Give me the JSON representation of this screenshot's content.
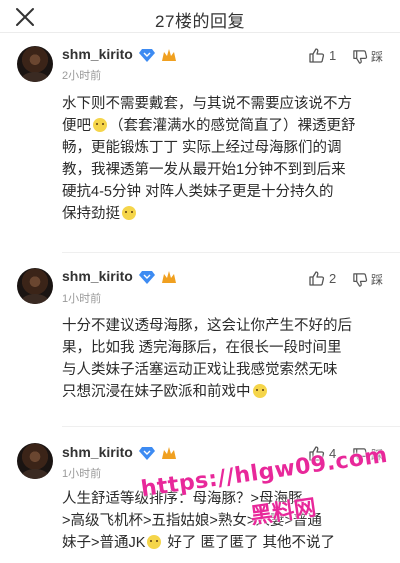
{
  "header": {
    "title": "27楼的回复",
    "close_icon": "close-icon"
  },
  "comments": [
    {
      "username": "shm_kirito",
      "time": "2小时前",
      "likes": "1",
      "dislike_label": "踩",
      "lines": [
        "水下则不需要戴套，与其说不需要应该说不方",
        "便吧",
        "（套套灌满水的感觉简直了）裸透更舒",
        "畅，更能锻炼丁丁 实际上经过母海豚们的调",
        "教，我裸透第一发从最开始1分钟不到到后来",
        "硬抗4-5分钟 对阵人类妹子更是十分持久的",
        "保持劲挺"
      ]
    },
    {
      "username": "shm_kirito",
      "time": "1小时前",
      "likes": "2",
      "dislike_label": "踩",
      "lines": [
        "十分不建议透母海豚，这会让你产生不好的后",
        "果，比如我 透完海豚后，在很长一段时间里",
        "与人类妹子活塞运动正戏让我感觉索然无味",
        "只想沉浸在妹子欧派和前戏中"
      ]
    },
    {
      "username": "shm_kirito",
      "time": "1小时前",
      "likes": "4",
      "dislike_label": "踩",
      "lines": [
        "人生舒适等级排序：母海豚？>母海豚",
        ">高级飞机杯>五指姑娘>熟女>人妻>普通",
        "妹子>普通JK",
        " 好了 匿了匿了 其他不说了"
      ]
    }
  ],
  "watermark": {
    "url": "https://hlgw09.com",
    "site_name": "黑料网"
  },
  "colors": {
    "accent_watermark": "#e8289a",
    "badge_blue": "#3d8bf2",
    "badge_orange": "#f0a020"
  }
}
